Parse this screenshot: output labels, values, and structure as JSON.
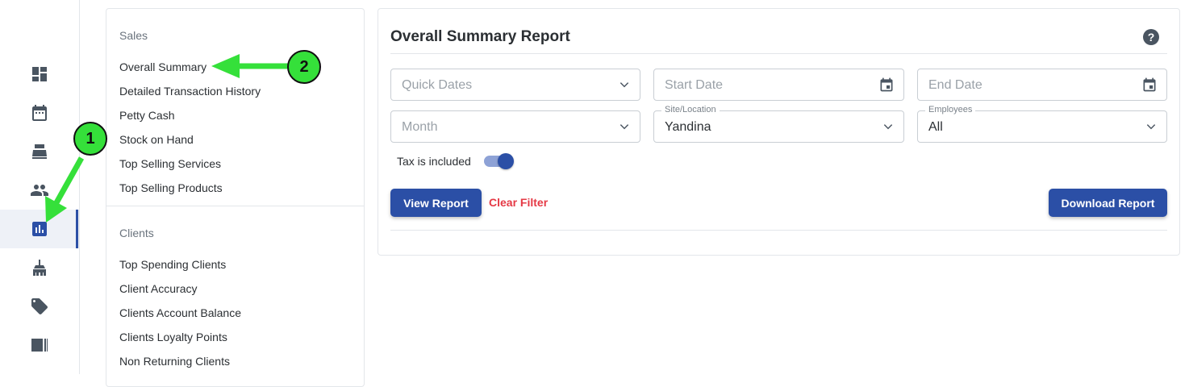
{
  "sidebar": {
    "icons": [
      "dashboard-icon",
      "calendar-icon",
      "register-icon",
      "people-icon",
      "reports-icon",
      "cleaning-icon",
      "tag-icon",
      "contact-card-icon"
    ],
    "active": "reports-icon"
  },
  "report_menu": {
    "sales_title": "Sales",
    "sales_items": [
      "Overall Summary",
      "Detailed Transaction History",
      "Petty Cash",
      "Stock on Hand",
      "Top Selling Services",
      "Top Selling Products"
    ],
    "clients_title": "Clients",
    "clients_items": [
      "Top Spending Clients",
      "Client Accuracy",
      "Clients Account Balance",
      "Clients Loyalty Points",
      "Non Returning Clients"
    ]
  },
  "report": {
    "title": "Overall Summary Report",
    "help": "?",
    "filters": {
      "quick_dates_placeholder": "Quick Dates",
      "start_date_placeholder": "Start Date",
      "end_date_placeholder": "End Date",
      "month_placeholder": "Month",
      "site_label": "Site/Location",
      "site_value": "Yandina",
      "employees_label": "Employees",
      "employees_value": "All"
    },
    "tax_label": "Tax is included",
    "tax_included": true,
    "view_button": "View Report",
    "clear_button": "Clear Filter",
    "download_button": "Download Report"
  },
  "annotations": {
    "badge_1": "1",
    "badge_2": "2",
    "arrow_color": "#35e03a"
  },
  "colors": {
    "primary": "#2b4fa6",
    "danger": "#e53945"
  }
}
